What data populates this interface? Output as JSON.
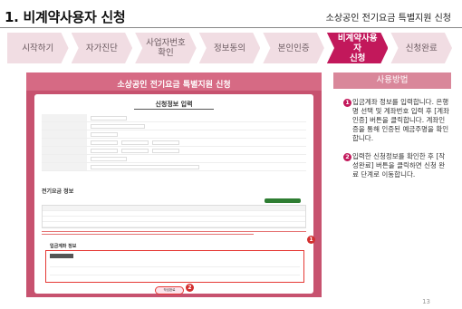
{
  "header": {
    "title": "1. 비계약사용자 신청",
    "subtitle": "소상공인 전기요금 특별지원 신청"
  },
  "steps": [
    {
      "label": "시작하기",
      "active": false
    },
    {
      "label": "자가진단",
      "active": false
    },
    {
      "label": "사업자번호\n확인",
      "active": false
    },
    {
      "label": "정보동의",
      "active": false
    },
    {
      "label": "본인인증",
      "active": false
    },
    {
      "label": "비계약사용자\n신청",
      "active": true
    },
    {
      "label": "신청완료",
      "active": false
    }
  ],
  "screenshot": {
    "banner_title": "소상공인 전기요금 특별지원 신청",
    "card_title": "신청정보 입력",
    "section_electric": "전기요금 정보",
    "section_refund": "입금계좌 정보",
    "submit_label": "작성완료",
    "marker_1": "1",
    "marker_2": "2"
  },
  "panel": {
    "heading": "사용방법",
    "items": [
      {
        "num": "1",
        "text": "입금계좌 정보를 입력합니다. 은행명 선택 및 계좌번호 입력 후 [계좌인증] 버튼을 클릭합니다. 계좌인증을 통해 인증된 예금주명을 확인합니다."
      },
      {
        "num": "2",
        "text": "입력한 신청정보를 확인한 후 [작성완료] 버튼을 클릭하면 신청 완료 단계로 이동합니다."
      }
    ]
  },
  "page_number": "13",
  "colors": {
    "accent": "#c2185b",
    "step_inactive": "#f1dde3",
    "panel_head": "#d9879a",
    "highlight": "#e53935"
  }
}
